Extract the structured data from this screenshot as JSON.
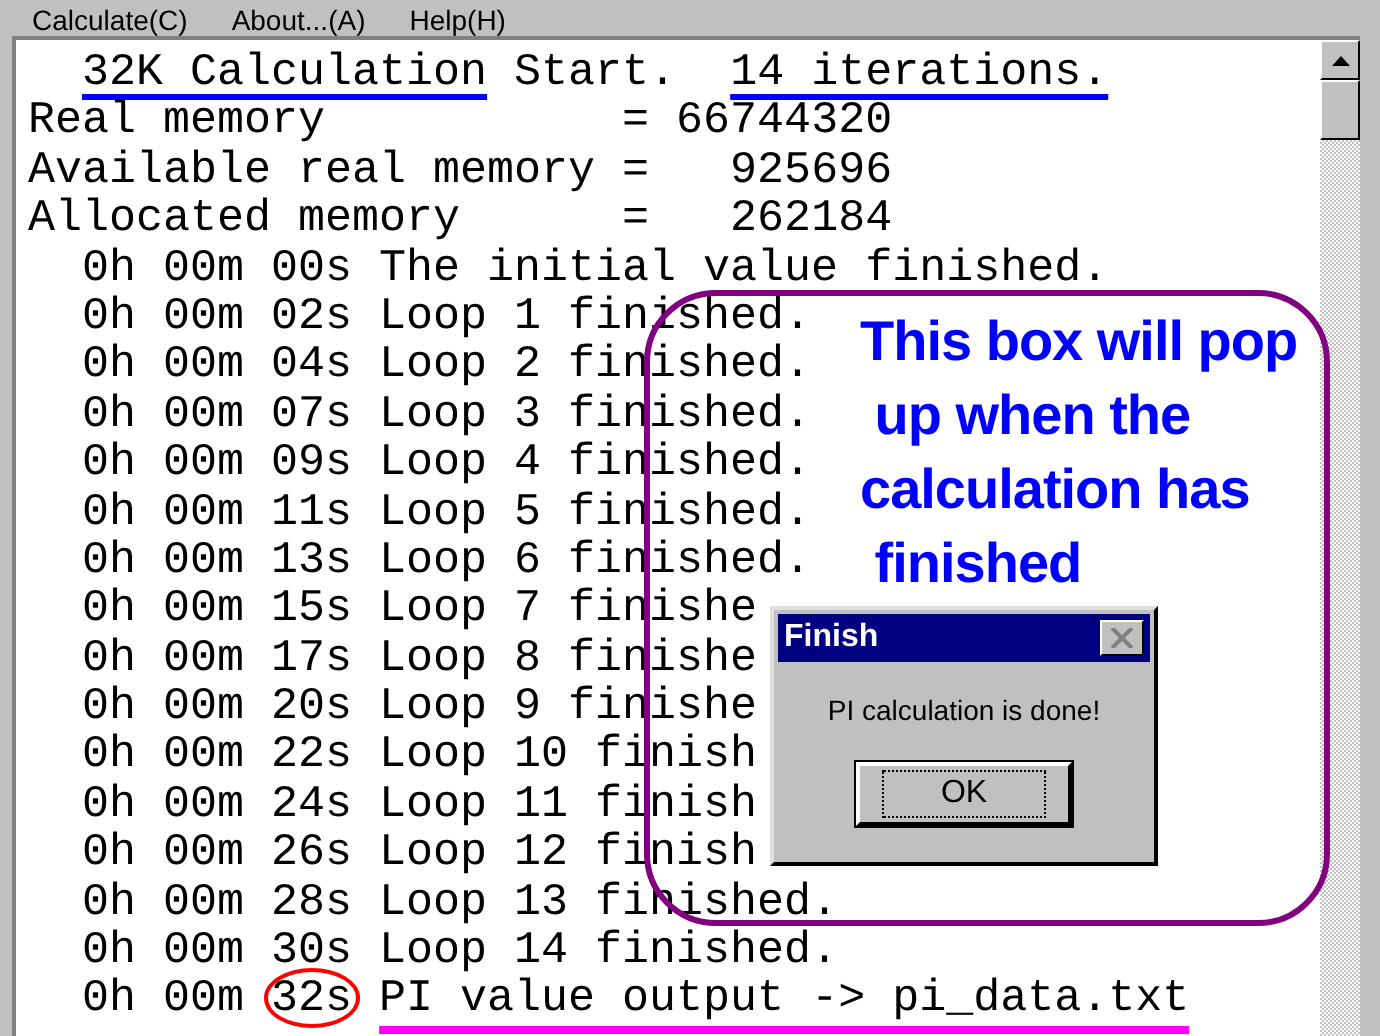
{
  "menu": [
    {
      "label": "Calculate(C)"
    },
    {
      "label": "About...(A)"
    },
    {
      "label": "Help(H)"
    }
  ],
  "log": {
    "lines": [
      {
        "indented": true,
        "segments": [
          {
            "text": "32K Calculation",
            "kind": "underline"
          },
          {
            "text": " Start.  ",
            "kind": "plain"
          },
          {
            "text": "14 iterations.",
            "kind": "underline"
          }
        ]
      },
      {
        "indented": false,
        "segments": [
          {
            "text": "Real memory           = 66744320",
            "kind": "plain"
          }
        ]
      },
      {
        "indented": false,
        "segments": [
          {
            "text": "Available real memory =   925696",
            "kind": "plain"
          }
        ]
      },
      {
        "indented": false,
        "segments": [
          {
            "text": "Allocated memory      =   262184",
            "kind": "plain"
          }
        ]
      },
      {
        "indented": true,
        "segments": [
          {
            "text": "0h 00m 00s The initial value finished.",
            "kind": "plain"
          }
        ]
      },
      {
        "indented": true,
        "segments": [
          {
            "text": "0h 00m 02s Loop 1 finished.",
            "kind": "plain"
          }
        ]
      },
      {
        "indented": true,
        "segments": [
          {
            "text": "0h 00m 04s Loop 2 finished.",
            "kind": "plain"
          }
        ]
      },
      {
        "indented": true,
        "segments": [
          {
            "text": "0h 00m 07s Loop 3 finished.",
            "kind": "plain"
          }
        ]
      },
      {
        "indented": true,
        "segments": [
          {
            "text": "0h 00m 09s Loop 4 finished.",
            "kind": "plain"
          }
        ]
      },
      {
        "indented": true,
        "segments": [
          {
            "text": "0h 00m 11s Loop 5 finished.",
            "kind": "plain"
          }
        ]
      },
      {
        "indented": true,
        "segments": [
          {
            "text": "0h 00m 13s Loop 6 finished.",
            "kind": "plain"
          }
        ]
      },
      {
        "indented": true,
        "segments": [
          {
            "text": "0h 00m 15s Loop 7 finishe",
            "kind": "plain"
          }
        ]
      },
      {
        "indented": true,
        "segments": [
          {
            "text": "0h 00m 17s Loop 8 finishe",
            "kind": "plain"
          }
        ]
      },
      {
        "indented": true,
        "segments": [
          {
            "text": "0h 00m 20s Loop 9 finishe",
            "kind": "plain"
          }
        ]
      },
      {
        "indented": true,
        "segments": [
          {
            "text": "0h 00m 22s Loop 10 finish",
            "kind": "plain"
          }
        ]
      },
      {
        "indented": true,
        "segments": [
          {
            "text": "0h 00m 24s Loop 11 finish",
            "kind": "plain"
          }
        ]
      },
      {
        "indented": true,
        "segments": [
          {
            "text": "0h 00m 26s Loop 12 finish",
            "kind": "plain"
          }
        ]
      },
      {
        "indented": true,
        "segments": [
          {
            "text": "0h 00m 28s Loop 13 finished.",
            "kind": "plain"
          }
        ]
      },
      {
        "indented": true,
        "segments": [
          {
            "text": "0h 00m 30s Loop 14 finished.",
            "kind": "plain"
          }
        ]
      },
      {
        "indented": true,
        "segments": [
          {
            "text": "0h 00m ",
            "kind": "plain"
          },
          {
            "text": "32s",
            "kind": "circled"
          },
          {
            "text": "PI value output -> pi_data.txt",
            "kind": "highlight"
          }
        ]
      }
    ]
  },
  "callout": {
    "text": "This box will pop\n up when the\ncalculation has\n finished"
  },
  "dialog": {
    "title": "Finish",
    "message": "PI calculation is done!",
    "button": "OK"
  }
}
